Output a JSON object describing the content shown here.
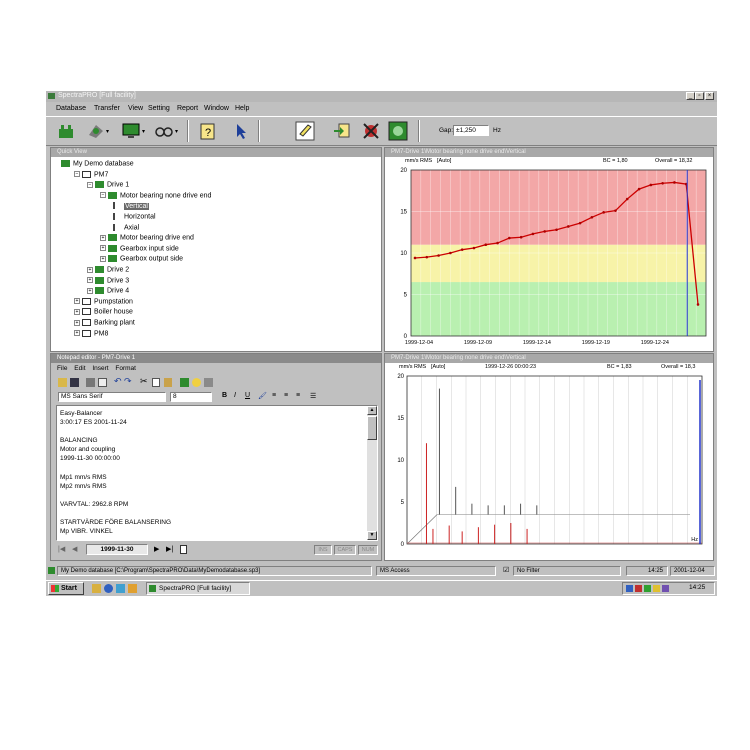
{
  "window": {
    "title": "SpectraPRO [Full facility]"
  },
  "menu": [
    "Database",
    "Transfer",
    "View",
    "Setting",
    "Report",
    "Window",
    "Help"
  ],
  "toolbar": {
    "gap_label": "Gap:",
    "gap_value": "±1,250",
    "gap_unit": "Hz"
  },
  "quickview": {
    "title": "Quick View",
    "tree": [
      {
        "label": "My Demo database",
        "level": 0,
        "icon": "database-icon"
      },
      {
        "label": "PM7",
        "level": 1,
        "icon": "machine-icon"
      },
      {
        "label": "Drive 1",
        "level": 2,
        "icon": "drive-icon"
      },
      {
        "label": "Motor bearing none drive end",
        "level": 3,
        "icon": "point-icon"
      },
      {
        "label": "Vertical",
        "level": 4,
        "icon": "direction-icon",
        "selected": true
      },
      {
        "label": "Horizontal",
        "level": 4,
        "icon": "direction-icon"
      },
      {
        "label": "Axial",
        "level": 4,
        "icon": "direction-icon"
      },
      {
        "label": "Motor bearing drive end",
        "level": 3,
        "icon": "point-icon"
      },
      {
        "label": "Gearbox input side",
        "level": 3,
        "icon": "point-icon"
      },
      {
        "label": "Gearbox output side",
        "level": 3,
        "icon": "point-icon"
      },
      {
        "label": "Drive 2",
        "level": 2,
        "icon": "drive-icon"
      },
      {
        "label": "Drive 3",
        "level": 2,
        "icon": "drive-icon"
      },
      {
        "label": "Drive 4",
        "level": 2,
        "icon": "drive-icon"
      },
      {
        "label": "Pumpstation",
        "level": 1,
        "icon": "machine-icon"
      },
      {
        "label": "Boiler house",
        "level": 1,
        "icon": "machine-icon"
      },
      {
        "label": "Barking plant",
        "level": 1,
        "icon": "machine-icon"
      },
      {
        "label": "PM8",
        "level": 1,
        "icon": "machine-icon"
      }
    ]
  },
  "notepad": {
    "title": "Notepad editor - PM7-Drive 1",
    "menu": [
      "File",
      "Edit",
      "Insert",
      "Format"
    ],
    "font": "MS Sans Serif",
    "font_size": "8",
    "lines": [
      "Easy-Balancer",
      "3:00:17 ES 2001-11-24",
      "",
      "BALANCING",
      "Motor and coupling",
      "1999-11-30 00:00:00",
      "",
      "Mp1 mm/s  RMS",
      "Mp2 mm/s  RMS",
      "",
      "VARVTAL: 2962.8 RPM",
      "",
      "STARTVÄRDE FÖRE BALANSERING",
      "Mp  VIBR.          VINKEL"
    ],
    "nav_date": "1999-11-30",
    "status_ins": "INS",
    "status_caps": "CAPS",
    "status_num": "NUM"
  },
  "trend": {
    "title": "PM7-Drive 1\\Motor bearing none drive end\\Vertical",
    "header_units": "mm/s RMS",
    "header_mode": "[Auto]",
    "header_bc": "BC = 1,80",
    "header_overall": "Overall = 18,32"
  },
  "spectrum": {
    "title": "PM7-Drive 1\\Motor bearing none drive end\\Vertical",
    "header_units": "mm/s RMS",
    "header_mode": "[Auto]",
    "header_date": "1999-12-26 00:00:23",
    "header_bc": "BC = 1,83",
    "header_overall": "Overall = 18,3",
    "x_unit": "Hz"
  },
  "chart_data": [
    {
      "type": "line",
      "x_ticks": [
        "1999-12-04",
        "1999-12-09",
        "1999-12-14",
        "1999-12-19",
        "1999-12-24"
      ],
      "y_ticks": [
        "20",
        "15",
        "10",
        "5",
        "0"
      ],
      "ylim": [
        0,
        20
      ],
      "zones": [
        {
          "from": 0,
          "to": 6.5,
          "color": "#b9f0b0"
        },
        {
          "from": 6.5,
          "to": 11,
          "color": "#f7f3a8"
        },
        {
          "from": 11,
          "to": 20,
          "color": "#f3a7a7"
        }
      ],
      "series": [
        {
          "color": "#cc0000",
          "x": [
            0,
            1,
            2,
            3,
            4,
            5,
            6,
            7,
            8,
            9,
            10,
            11,
            12,
            13,
            14,
            15,
            16,
            17,
            18,
            19,
            20,
            21,
            22,
            23,
            24
          ],
          "values": [
            9.4,
            9.5,
            9.7,
            10.0,
            10.4,
            10.6,
            11.0,
            11.2,
            11.8,
            11.9,
            12.3,
            12.6,
            12.8,
            13.2,
            13.6,
            14.3,
            14.9,
            15.1,
            16.5,
            17.7,
            18.2,
            18.4,
            18.5,
            18.3,
            3.8
          ]
        }
      ]
    },
    {
      "type": "bar",
      "ylim": [
        0,
        20
      ],
      "y_ticks": [
        "20",
        "15",
        "10",
        "5",
        "0"
      ],
      "peaks": [
        {
          "f": 0.06,
          "v": 12.0,
          "color": "#cc2222"
        },
        {
          "f": 0.1,
          "v": 18.5,
          "color": "#555555"
        },
        {
          "f": 0.15,
          "v": 6.8,
          "color": "#555555"
        },
        {
          "f": 0.08,
          "v": 1.8,
          "color": "#cc2222"
        },
        {
          "f": 0.13,
          "v": 2.2,
          "color": "#cc2222"
        },
        {
          "f": 0.17,
          "v": 1.5,
          "color": "#cc2222"
        },
        {
          "f": 0.22,
          "v": 2.0,
          "color": "#cc2222"
        },
        {
          "f": 0.27,
          "v": 2.3,
          "color": "#cc2222"
        },
        {
          "f": 0.32,
          "v": 2.5,
          "color": "#cc2222"
        },
        {
          "f": 0.37,
          "v": 1.8,
          "color": "#cc2222"
        },
        {
          "f": 0.2,
          "v": 4.8,
          "color": "#555555"
        },
        {
          "f": 0.25,
          "v": 4.6,
          "color": "#555555"
        },
        {
          "f": 0.3,
          "v": 4.6,
          "color": "#555555"
        },
        {
          "f": 0.35,
          "v": 4.8,
          "color": "#555555"
        },
        {
          "f": 0.4,
          "v": 4.6,
          "color": "#555555"
        }
      ]
    }
  ],
  "statusbar": {
    "path": "My Demo database [C:\\Program\\SpectraPRO\\Data\\MyDemodatabase.sp3]",
    "access": "MS Access",
    "filter": "No Filter",
    "time": "14:25",
    "date": "2001-12-04"
  },
  "taskbar": {
    "start": "Start",
    "app": "SpectraPRO [Full facility]",
    "clock": "14:25"
  }
}
